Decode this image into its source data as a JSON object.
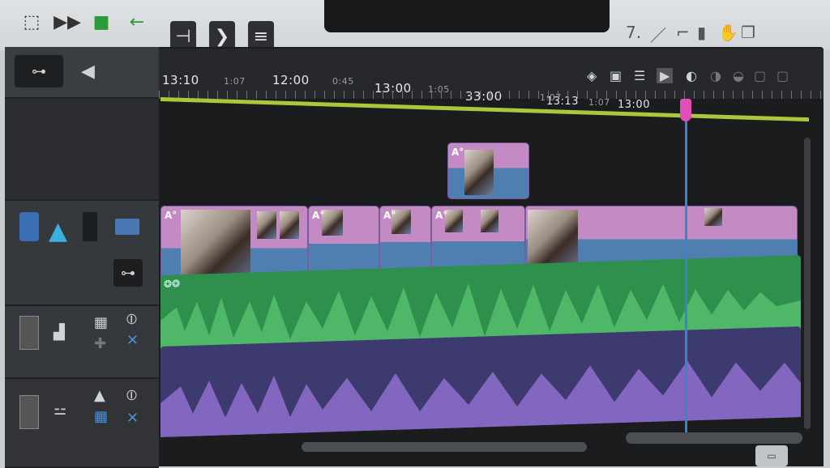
{
  "toolbar": {
    "left_icons": [
      "crop-icon",
      "skip-icon",
      "clip-icon",
      "back-arrow-icon"
    ],
    "nav_buttons": [
      "step-back-icon",
      "step-forward-icon",
      "menu-lines-icon"
    ],
    "right_icons": [
      "pen-icon",
      "pencil-icon",
      "bracket-icon",
      "scissors-icon",
      "hand-icon",
      "copy-icon"
    ],
    "right_text": "7."
  },
  "timeline": {
    "ruler_labels": [
      {
        "text": "13:10",
        "major": true
      },
      {
        "text": "1:07",
        "major": false
      },
      {
        "text": "12:00",
        "major": true
      },
      {
        "text": "0:45",
        "major": false
      },
      {
        "text": "13:00",
        "major": true
      },
      {
        "text": "1:05",
        "major": false
      },
      {
        "text": "33:00",
        "major": true
      },
      {
        "text": "1:07",
        "major": false
      },
      {
        "text": "13:13",
        "major": true
      },
      {
        "text": "1:07",
        "major": false
      },
      {
        "text": "13:00",
        "major": true
      }
    ],
    "ruler_tools": [
      "marker-icon",
      "calendar-icon",
      "list-icon",
      "play-icon",
      "record-icon"
    ]
  },
  "tracks": {
    "video_clip_label": "A°",
    "overlay_clip_label": "A°",
    "audio_label": "❂❂"
  },
  "colors": {
    "video_top": "#c48ac4",
    "video_bottom": "#4f7fb0",
    "audio_green": "#2f8f4c",
    "audio_purple": "#3c3a6e",
    "playhead": "#3d83c7",
    "range_bar": "#a9c83a"
  }
}
